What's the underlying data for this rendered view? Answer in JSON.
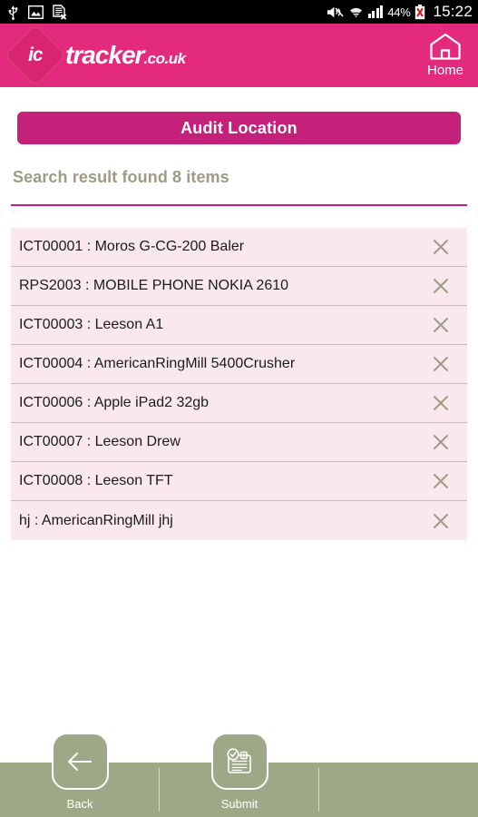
{
  "statusbar": {
    "icons_left": [
      "usb-icon",
      "screenshot-image-icon",
      "sim-card-error-icon"
    ],
    "icons_right": [
      "mute-icon",
      "wifi-icon",
      "signal-bars-icon",
      "battery-error-icon"
    ],
    "battery_percent": "44%",
    "clock": "15:22"
  },
  "header": {
    "logo_mark": "ic",
    "logo_word": "tracker",
    "logo_tld": ".co.uk",
    "home_label": "Home",
    "home_icon": "home-icon",
    "background_color": "#e32a7c"
  },
  "main": {
    "audit_button_label": "Audit Location",
    "audit_button_color": "#c4217a",
    "result_heading": "Search result found 8 items",
    "result_heading_color": "#9c9c86",
    "rule_color": "#c4217a",
    "row_background": "#f9e9ef",
    "remove_icon": "close-x-icon",
    "items": [
      {
        "label": "ICT00001 : Moros G-CG-200 Baler"
      },
      {
        "label": "RPS2003 : MOBILE PHONE NOKIA 2610"
      },
      {
        "label": "ICT00003 : Leeson A1"
      },
      {
        "label": "ICT00004 : AmericanRingMill 5400Crusher"
      },
      {
        "label": "ICT00006 : Apple iPad2 32gb"
      },
      {
        "label": "ICT00007 : Leeson Drew"
      },
      {
        "label": "ICT00008 : Leeson TFT"
      },
      {
        "label": "hj : AmericanRingMill jhj"
      }
    ]
  },
  "bottombar": {
    "background_color": "#9da886",
    "items": [
      {
        "label": "Back",
        "icon": "arrow-left-icon"
      },
      {
        "label": "Submit",
        "icon": "save-document-check-icon"
      }
    ]
  }
}
